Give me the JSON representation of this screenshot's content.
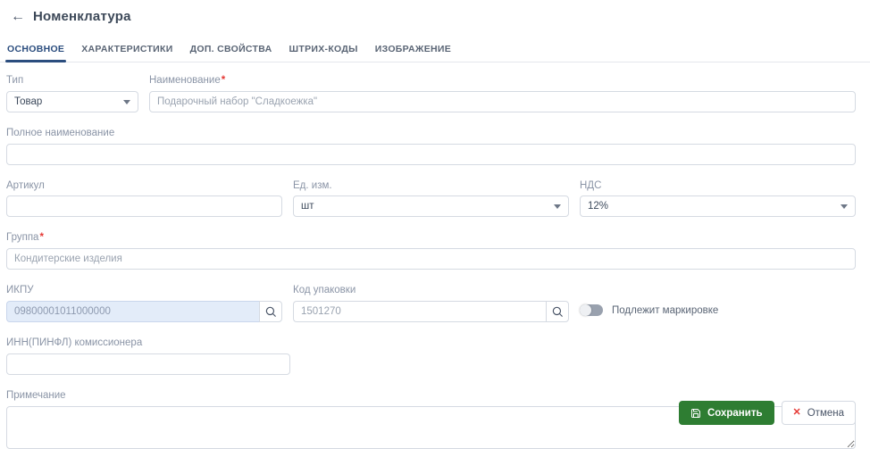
{
  "header": {
    "back_icon": "←",
    "title": "Номенклатура"
  },
  "tabs": [
    {
      "label": "ОСНОВНОЕ",
      "active": true
    },
    {
      "label": "ХАРАКТЕРИСТИКИ",
      "active": false
    },
    {
      "label": "ДОП. СВОЙСТВА",
      "active": false
    },
    {
      "label": "ШТРИХ-КОДЫ",
      "active": false
    },
    {
      "label": "ИЗОБРАЖЕНИЕ",
      "active": false
    }
  ],
  "form": {
    "required_mark": "*",
    "type": {
      "label": "Тип",
      "value": "Товар"
    },
    "name": {
      "label": "Наименование",
      "required": true,
      "value": "Подарочный набор \"Сладкоежка\""
    },
    "full_name": {
      "label": "Полное наименование",
      "value": ""
    },
    "article": {
      "label": "Артикул",
      "value": ""
    },
    "unit": {
      "label": "Ед. изм.",
      "value": "шт"
    },
    "vat": {
      "label": "НДС",
      "value": "12%"
    },
    "group": {
      "label": "Группа",
      "required": true,
      "value": "Кондитерские изделия"
    },
    "ikpu": {
      "label": "ИКПУ",
      "value": "09800001011000000"
    },
    "package_code": {
      "label": "Код упаковки",
      "value": "1501270"
    },
    "marking": {
      "label": "Подлежит маркировке",
      "enabled": false
    },
    "inn": {
      "label": "ИНН(ПИНФЛ) комиссионера",
      "value": ""
    },
    "note": {
      "label": "Примечание",
      "value": ""
    }
  },
  "footer": {
    "save_label": "Сохранить",
    "cancel_label": "Отмена",
    "cancel_icon": "✕"
  },
  "icons": {
    "search": "magnifier",
    "save": "floppy-disk"
  },
  "colors": {
    "accent_green": "#2e7d32",
    "danger_red": "#e53935",
    "active_tab_blue": "#2b4d7e",
    "ikpu_field_bg": "#e3ecf9"
  }
}
